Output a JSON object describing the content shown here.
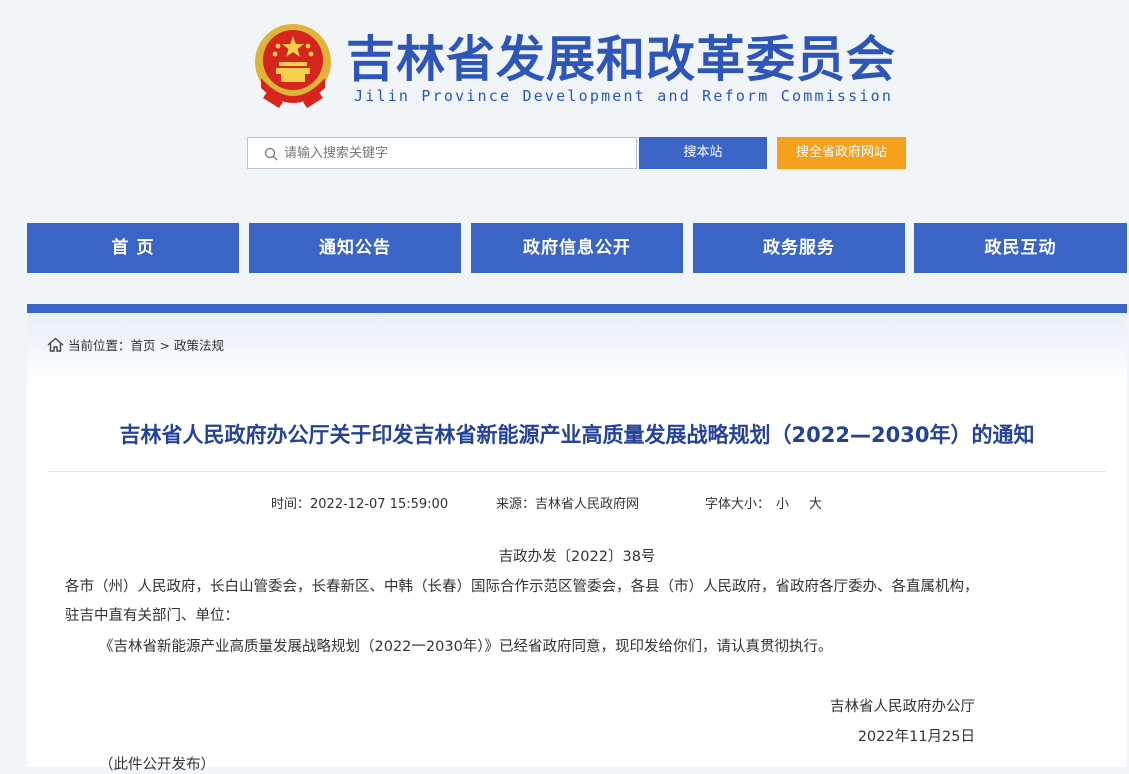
{
  "header": {
    "title": "吉林省发展和改革委员会",
    "subtitle": "Jilin Province Development and Reform Commission"
  },
  "search": {
    "placeholder": "请输入搜索关键字",
    "site_button": "搜本站",
    "province_button": "搜全省政府网站"
  },
  "nav": {
    "items": [
      {
        "label": "首 页"
      },
      {
        "label": "通知公告"
      },
      {
        "label": "政府信息公开"
      },
      {
        "label": "政务服务"
      },
      {
        "label": "政民互动"
      }
    ]
  },
  "breadcrumb": {
    "prefix": "当前位置：",
    "home": "首页",
    "separator": ">",
    "current": "政策法规"
  },
  "article": {
    "title": "吉林省人民政府办公厅关于印发吉林省新能源产业高质量发展战略规划（2022—2030年）的通知",
    "time_label": "时间：",
    "time": "2022-12-07 15:59:00",
    "source_label": "来源：",
    "source": "吉林省人民政府网",
    "font_size_label": "字体大小：",
    "font_small": "小",
    "font_large": "大",
    "doc_number": "吉政办发〔2022〕38号",
    "para1": "各市（州）人民政府，长白山管委会，长春新区、中韩（长春）国际合作示范区管委会，各县（市）人民政府，省政府各厅委办、各直属机构，",
    "para2": "驻吉中直有关部门、单位：",
    "para3": "《吉林省新能源产业高质量发展战略规划（2022一2030年）》已经省政府同意，现印发给你们，请认真贯彻执行。",
    "signature": "吉林省人民政府办公厅",
    "sign_date": "2022年11月25日",
    "public_note": "（此件公开发布）"
  },
  "colors": {
    "primary": "#3a64c6",
    "accent": "#f5a11c",
    "title": "#25429a",
    "background": "#f1f5f8"
  },
  "icons": {
    "emblem": "national-emblem-icon",
    "search": "search-icon",
    "home": "home-icon"
  }
}
